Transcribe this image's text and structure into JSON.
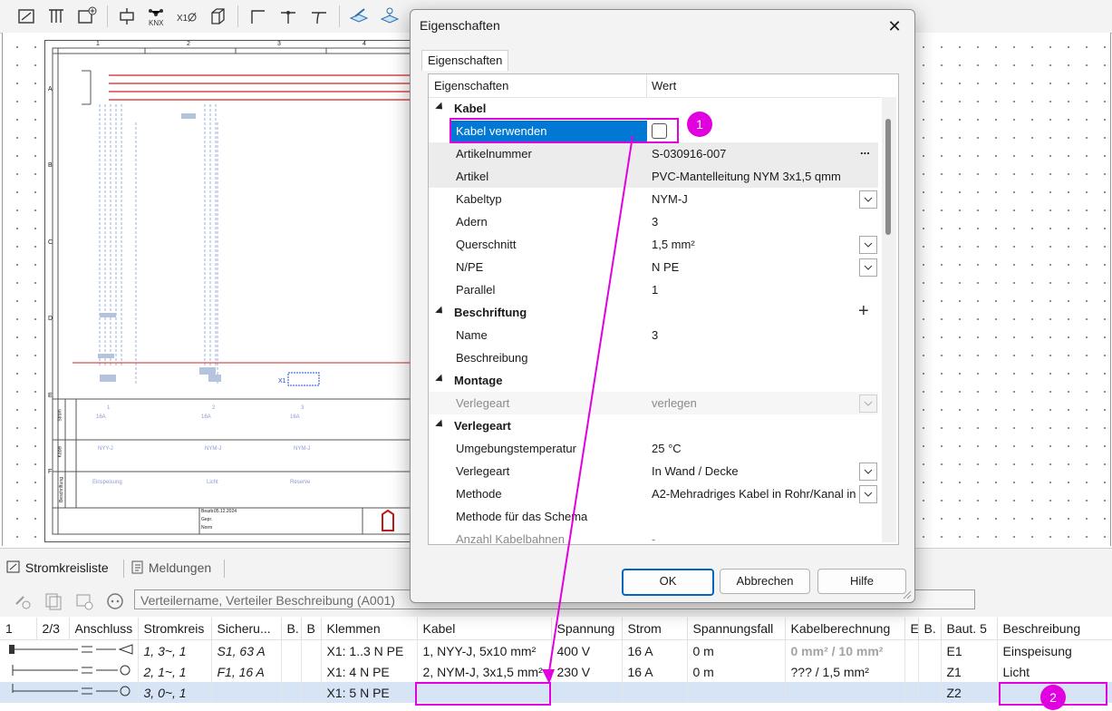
{
  "dialog": {
    "title": "Eigenschaften",
    "tab": "Eigenschaften",
    "header": {
      "name": "Eigenschaften",
      "value": "Wert"
    },
    "rows": [
      {
        "name": "Kabel"
      },
      {
        "name": "Kabel verwenden",
        "value": ""
      },
      {
        "name": "Artikelnummer",
        "value": "S-030916-007"
      },
      {
        "name": "Artikel",
        "value": "PVC-Mantelleitung NYM 3x1,5  qmm"
      },
      {
        "name": "Kabeltyp",
        "value": "NYM-J"
      },
      {
        "name": "Adern",
        "value": "3"
      },
      {
        "name": "Querschnitt",
        "value": "1,5 mm²"
      },
      {
        "name": "N/PE",
        "value": "N PE"
      },
      {
        "name": "Parallel",
        "value": "1"
      },
      {
        "name": "Beschriftung"
      },
      {
        "name": "Name",
        "value": "3"
      },
      {
        "name": "Beschreibung",
        "value": ""
      },
      {
        "name": "Montage"
      },
      {
        "name": "Verlegeart",
        "value": "verlegen"
      },
      {
        "name": "Verlegeart"
      },
      {
        "name": "Umgebungstemperatur",
        "value": "25 °C"
      },
      {
        "name": "Verlegeart",
        "value": "In Wand / Decke"
      },
      {
        "name": "Methode",
        "value": "A2-Mehradriges Kabel in Rohr/Kanal in"
      },
      {
        "name": "Methode für das Schema",
        "value": ""
      },
      {
        "name": "Anzahl Kabelbahnen",
        "value": "-"
      }
    ],
    "buttons": {
      "ok": "OK",
      "cancel": "Abbrechen",
      "help": "Hilfe"
    },
    "ellipsis": "...",
    "add": "+"
  },
  "bottom_tabs": [
    "Stromkreisliste",
    "Meldungen"
  ],
  "search": {
    "placeholder": "Verteilername, Verteiler Beschreibung (A001)"
  },
  "table": {
    "columns": [
      "1",
      "2/3",
      "Anschluss",
      "Stromkreis",
      "Sicheru...",
      "B.",
      "B",
      "Klemmen",
      "Kabel",
      "Spannung",
      "Strom",
      "Spannungsfall",
      "Kabelberechnung",
      "E",
      "B.",
      "Baut. 5",
      "Beschreibung"
    ],
    "rows": [
      {
        "stromkreis": "1, 3~, 1",
        "sicherung": "S1, 63 A",
        "klemmen": "X1: 1..3 N PE",
        "kabel": "1, NYY-J, 5x10 mm²",
        "spannung": "400 V",
        "strom": "16 A",
        "spannungsfall": "0 m",
        "kabelberechnung": "0 mm² / 10 mm²",
        "baut5": "E1",
        "beschreibung": "Einspeisung"
      },
      {
        "stromkreis": "2, 1~, 1",
        "sicherung": "F1, 16 A",
        "klemmen": "X1: 4 N PE",
        "kabel": "2, NYM-J, 3x1,5 mm²",
        "spannung": "230 V",
        "strom": "16 A",
        "spannungsfall": "0 m",
        "kabelberechnung": "??? / 1,5 mm²",
        "baut5": "Z1",
        "beschreibung": "Licht"
      },
      {
        "stromkreis": "3, 0~, 1",
        "sicherung": "",
        "klemmen": "X1: 5 N PE",
        "kabel": "",
        "spannung": "",
        "strom": "",
        "spannungsfall": "",
        "kabelberechnung": "",
        "baut5": "Z2",
        "beschreibung": ""
      }
    ]
  },
  "schematic": {
    "columns": [
      "1",
      "2",
      "3",
      "4"
    ],
    "rows": [
      "A",
      "B",
      "C",
      "D",
      "E",
      "F"
    ],
    "circuits": [
      {
        "num": "1",
        "fuse": "16A",
        "cable": "NYY-J",
        "label": "Einspeisung"
      },
      {
        "num": "2",
        "fuse": "16A",
        "cable": "NYM-J",
        "label": "Licht"
      },
      {
        "num": "3",
        "fuse": "16A",
        "cable": "NYM-J",
        "label": "Reserve"
      }
    ],
    "side_labels": [
      "Strom",
      "Kabel",
      "Beschriftung"
    ],
    "title_block": [
      "Bearb.",
      "Gepr.",
      "Norm"
    ],
    "date": "05.12.2024"
  },
  "annotations": {
    "badge1": "1",
    "badge2": "2"
  },
  "colors": {
    "accent": "#0067c0",
    "highlight": "#e000e0",
    "selected_row": "#d6e4f6"
  }
}
